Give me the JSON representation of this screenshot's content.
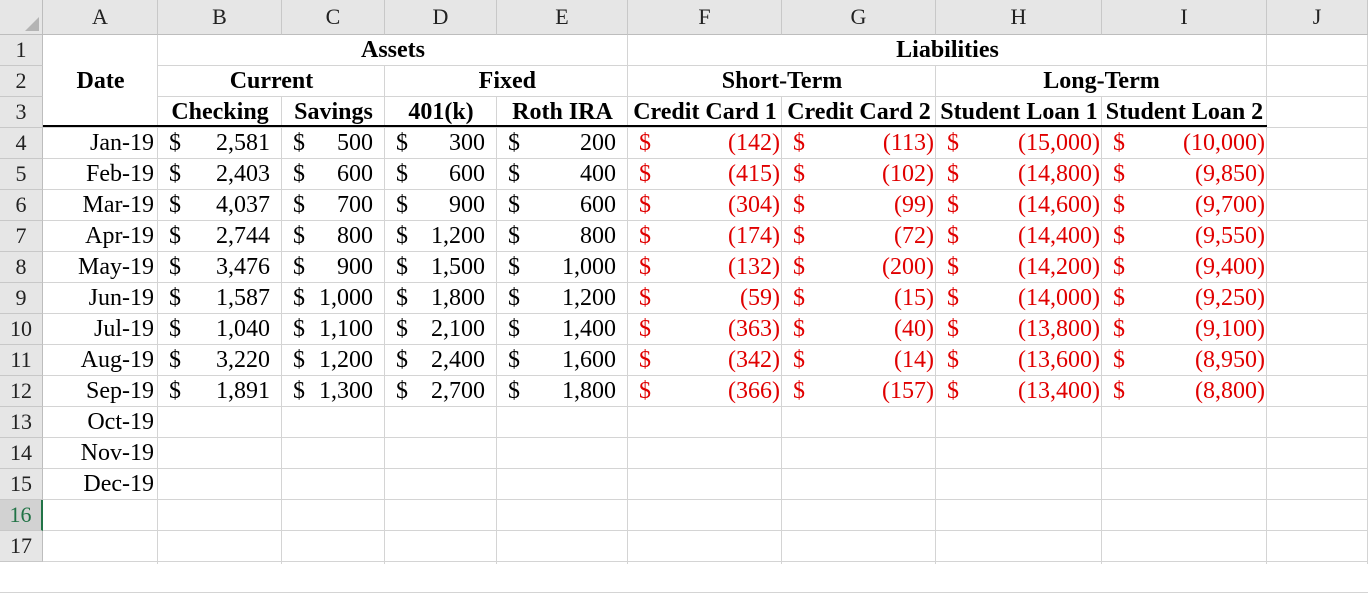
{
  "columns": [
    "A",
    "B",
    "C",
    "D",
    "E",
    "F",
    "G",
    "H",
    "I",
    "J"
  ],
  "rows": [
    "1",
    "2",
    "3",
    "4",
    "5",
    "6",
    "7",
    "8",
    "9",
    "10",
    "11",
    "12",
    "13",
    "14",
    "15",
    "16",
    "17"
  ],
  "selected_row": "16",
  "headers": {
    "assets": "Assets",
    "liabilities": "Liabilities",
    "date": "Date",
    "current": "Current",
    "fixed": "Fixed",
    "short_term": "Short-Term",
    "long_term": "Long-Term",
    "checking": "Checking",
    "savings": "Savings",
    "k401": "401(k)",
    "roth": "Roth IRA",
    "cc1": "Credit Card 1",
    "cc2": "Credit Card 2",
    "sl1": "Student Loan 1",
    "sl2": "Student Loan 2"
  },
  "currency_symbol": "$",
  "dates": [
    "Jan-19",
    "Feb-19",
    "Mar-19",
    "Apr-19",
    "May-19",
    "Jun-19",
    "Jul-19",
    "Aug-19",
    "Sep-19",
    "Oct-19",
    "Nov-19",
    "Dec-19"
  ],
  "data": [
    [
      "2,581",
      "500",
      "300",
      "200",
      "(142)",
      "(113)",
      "(15,000)",
      "(10,000)"
    ],
    [
      "2,403",
      "600",
      "600",
      "400",
      "(415)",
      "(102)",
      "(14,800)",
      "(9,850)"
    ],
    [
      "4,037",
      "700",
      "900",
      "600",
      "(304)",
      "(99)",
      "(14,600)",
      "(9,700)"
    ],
    [
      "2,744",
      "800",
      "1,200",
      "800",
      "(174)",
      "(72)",
      "(14,400)",
      "(9,550)"
    ],
    [
      "3,476",
      "900",
      "1,500",
      "1,000",
      "(132)",
      "(200)",
      "(14,200)",
      "(9,400)"
    ],
    [
      "1,587",
      "1,000",
      "1,800",
      "1,200",
      "(59)",
      "(15)",
      "(14,000)",
      "(9,250)"
    ],
    [
      "1,040",
      "1,100",
      "2,100",
      "1,400",
      "(363)",
      "(40)",
      "(13,800)",
      "(9,100)"
    ],
    [
      "3,220",
      "1,200",
      "2,400",
      "1,600",
      "(342)",
      "(14)",
      "(13,600)",
      "(8,950)"
    ],
    [
      "1,891",
      "1,300",
      "2,700",
      "1,800",
      "(366)",
      "(157)",
      "(13,400)",
      "(8,800)"
    ]
  ],
  "colors": {
    "negative": "#e00000",
    "selection_green": "#217346",
    "header_bg": "#e6e6e6"
  }
}
